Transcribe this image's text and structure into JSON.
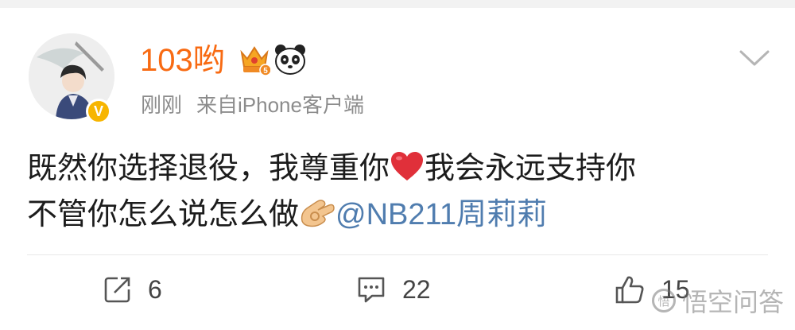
{
  "post": {
    "username": "103哟",
    "time": "刚刚",
    "source": "来自iPhone客户端",
    "verified_symbol": "V",
    "text_line1": "既然你选择退役，我尊重你",
    "text_line1b": "我会永远支持你",
    "text_line2": "不管你怎么说怎么做",
    "mention": "@NB211周莉莉",
    "emoji": [
      "red-heart",
      "ok-hand"
    ],
    "badges": [
      "crown-badge",
      "panda-badge"
    ]
  },
  "actions": {
    "repost_count": "6",
    "comment_count": "22",
    "like_count": "15"
  },
  "watermark": {
    "text": "悟空问答",
    "logo": "悟"
  },
  "colors": {
    "username": "#f86a12",
    "meta": "#8c8c8c",
    "mention": "#507daf",
    "verified": "#f7b500"
  }
}
